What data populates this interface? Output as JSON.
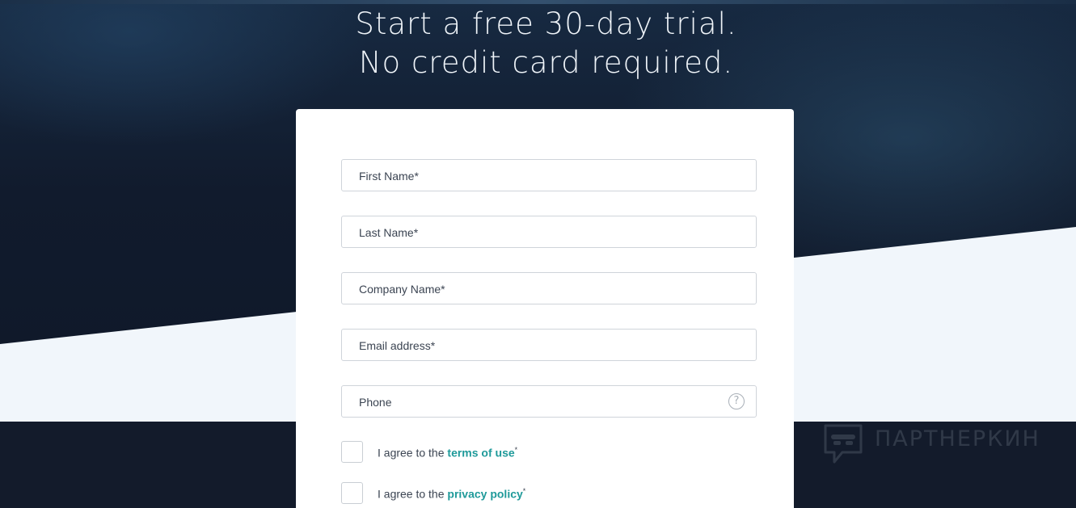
{
  "headline": {
    "line1": "Start a free 30-day trial.",
    "line2": "No credit card required."
  },
  "form": {
    "fields": [
      {
        "placeholder": "First Name*"
      },
      {
        "placeholder": "Last Name*"
      },
      {
        "placeholder": "Company Name*"
      },
      {
        "placeholder": "Email address*"
      },
      {
        "placeholder": "Phone",
        "help_icon": "question-circle-icon"
      }
    ],
    "agreements": [
      {
        "prefix": "I agree to the",
        "link": "terms of use",
        "mark": "*"
      },
      {
        "prefix": "I agree to the",
        "link": "privacy policy",
        "mark": "*"
      }
    ],
    "help_glyph": "?"
  },
  "watermark": {
    "text": "ПАРТНЕРКИН",
    "icon": "chat-mask-logo-icon"
  },
  "colors": {
    "background_dark": "#121b2c",
    "background_light": "#f1f6fb",
    "link": "#1f9a9a",
    "card": "#ffffff"
  }
}
